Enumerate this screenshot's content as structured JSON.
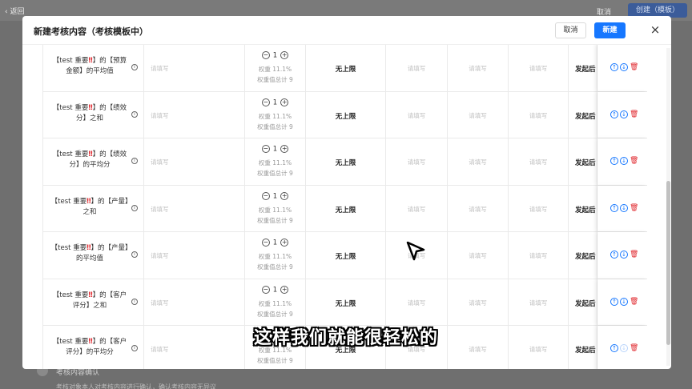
{
  "background": {
    "back_label": "返回",
    "cancel_label": "取消",
    "create_label": "创建（模板）",
    "bottom_label": "考核内容确认",
    "bottom_text": "考核对象本人对考核内容进行确认，确认考核内容无异议"
  },
  "modal": {
    "title": "新建考核内容（考核模板中）",
    "cancel_label": "取消",
    "new_label": "新建",
    "close_icon": "×"
  },
  "placeholder": "请填写",
  "rows": [
    {
      "prefix": "【test 重要",
      "bang": "‼",
      "suffix": "】的【预算金额】的平均值",
      "value": "1",
      "weight": "权重 11.1%",
      "weight_total": "权重值总计 9",
      "limit": "无上限",
      "start": "发起后"
    },
    {
      "prefix": "【test 重要",
      "bang": "‼",
      "suffix": "】的【绩效分】之和",
      "value": "1",
      "weight": "权重 11.1%",
      "weight_total": "权重值总计 9",
      "limit": "无上限",
      "start": "发起后"
    },
    {
      "prefix": "【test 重要",
      "bang": "‼",
      "suffix": "】的【绩效分】的平均分",
      "value": "1",
      "weight": "权重 11.1%",
      "weight_total": "权重值总计 9",
      "limit": "无上限",
      "start": "发起后"
    },
    {
      "prefix": "【test 重要",
      "bang": "‼",
      "suffix": "】的【产量】之和",
      "value": "1",
      "weight": "权重 11.1%",
      "weight_total": "权重值总计 9",
      "limit": "无上限",
      "start": "发起后"
    },
    {
      "prefix": "【test 重要",
      "bang": "‼",
      "suffix": "】的【产量】的平均值",
      "value": "1",
      "weight": "权重 11.1%",
      "weight_total": "权重值总计 9",
      "limit": "无上限",
      "start": "发起后"
    },
    {
      "prefix": "【test 重要",
      "bang": "‼",
      "suffix": "】的【客户评分】之和",
      "value": "1",
      "weight": "权重 11.1%",
      "weight_total": "权重值总计 9",
      "limit": "无上限",
      "start": "发起后"
    },
    {
      "prefix": "【test 重要",
      "bang": "‼",
      "suffix": "】的【客户评分】的平均分",
      "value": "1",
      "weight": "权重 11.1%",
      "weight_total": "权重值总计 9",
      "limit": "无上限",
      "start": "发起后"
    }
  ],
  "subtitle": "这样我们就能很轻松的",
  "icons": {
    "info": "info-icon",
    "minus": "minus-circle-icon",
    "plus": "plus-circle-icon",
    "up": "arrow-up-circle-icon",
    "down": "arrow-down-circle-icon",
    "delete": "trash-icon",
    "close": "close-icon",
    "cursor": "mouse-pointer-icon"
  },
  "colors": {
    "primary": "#1677ff",
    "danger": "#e0282e"
  }
}
